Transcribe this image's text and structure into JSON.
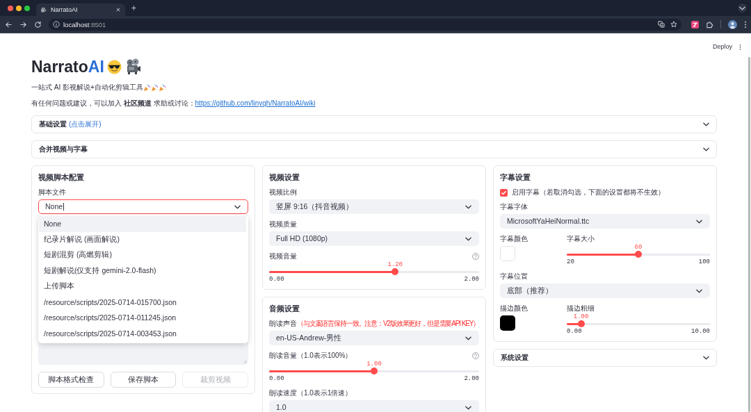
{
  "browser": {
    "tab_title": "NarratoAI",
    "address": {
      "host": "localhost",
      "port": ":8501"
    }
  },
  "toolbar": {
    "deploy": "Deploy"
  },
  "title": {
    "text": "Narrato",
    "accent": "AI"
  },
  "tagline": "一站式 AI 影视解说+自动化剪辑工具",
  "help": {
    "text": "有任何问题或建议，可以加入 **社区频道** 求助或讨论：",
    "link": "https://github.com/linyqh/NarratoAI/wiki"
  },
  "expanders": [
    {
      "title": "基础设置",
      "hint": "(点击展开)",
      "expanded": false
    },
    {
      "title": "合并视频与字幕",
      "expanded": false
    }
  ],
  "columns": [
    {
      "blocks": [
        {
          "kind": "card",
          "title": "视频脚本配置",
          "fields": [
            {
              "kind": "select",
              "label": "脚本文件",
              "value": "None",
              "focused": true,
              "options": [
                {
                  "label": "None",
                  "selected": true
                },
                {
                  "label": "纪录片解说 (画面解说)",
                  "selected": false
                },
                {
                  "label": "短剧混剪 (高燃剪辑)",
                  "selected": false
                },
                {
                  "label": "短剧解说(仅支持 gemini-2.0-flash)",
                  "selected": false
                },
                {
                  "label": "上传脚本",
                  "selected": false
                },
                {
                  "label": "/resource/scripts/2025-0714-015700.json",
                  "selected": false
                },
                {
                  "label": "/resource/scripts/2025-0714-011245.json",
                  "selected": false
                },
                {
                  "label": "/resource/scripts/2025-0714-003453.json",
                  "selected": false
                }
              ]
            },
            {
              "kind": "textarea"
            },
            {
              "kind": "buttons",
              "buttons": [
                {
                  "label": "脚本格式检查",
                  "disabled": false
                },
                {
                  "label": "保存脚本",
                  "disabled": false
                },
                {
                  "label": "裁剪视频",
                  "disabled": true
                }
              ]
            }
          ]
        }
      ]
    },
    {
      "blocks": [
        {
          "kind": "card",
          "title": "视频设置",
          "fields": [
            {
              "kind": "select",
              "label": "视频比例",
              "value": "竖屏 9:16（抖音视频）"
            },
            {
              "kind": "select",
              "label": "视频质量",
              "value": "Full HD (1080p)"
            },
            {
              "kind": "slider",
              "label": "视频音量",
              "help": true,
              "reading": "1.20",
              "level": 0.6,
              "min": "0.00",
              "max": "2.00"
            }
          ]
        },
        {
          "kind": "card",
          "title": "音频设置",
          "fields": [
            {
              "kind": "select",
              "label": "朗读声音",
              "note": "（与文案语言保持一致。注意：V2版效果更好，但是需要API KEY）",
              "value": "en-US-Andrew-男性"
            },
            {
              "kind": "slider",
              "label": "朗读音量（1.0表示100%）",
              "help": true,
              "reading": "1.00",
              "level": 0.5,
              "min": "0.00",
              "max": "2.00"
            },
            {
              "kind": "select",
              "label": "朗读速度（1.0表示1倍速）",
              "value": "1.0"
            }
          ]
        }
      ]
    },
    {
      "blocks": [
        {
          "kind": "card",
          "title": "字幕设置",
          "fields": [
            {
              "kind": "checkbox",
              "label": "启用字幕（若取消勾选，下面的设置都将不生效）",
              "checked": true
            },
            {
              "kind": "select",
              "label": "字幕字体",
              "value": "MicrosoftYaHeiNormal.ttc"
            },
            {
              "kind": "color_slider",
              "color_label": "字幕颜色",
              "color": "#ffffff",
              "slider": {
                "label": "字幕大小",
                "reading": "60",
                "level": 0.5,
                "min": "20",
                "max": "100"
              }
            },
            {
              "kind": "select",
              "label": "字幕位置",
              "value": "底部（推荐）"
            },
            {
              "kind": "color_slider",
              "color_label": "描边颜色",
              "color": "#000000",
              "slider": {
                "label": "描边粗细",
                "reading": "1.00",
                "level": 0.1,
                "min": "0.00",
                "max": "10.00"
              }
            }
          ]
        },
        {
          "kind": "expander",
          "title": "系统设置",
          "expanded": false
        }
      ]
    }
  ]
}
